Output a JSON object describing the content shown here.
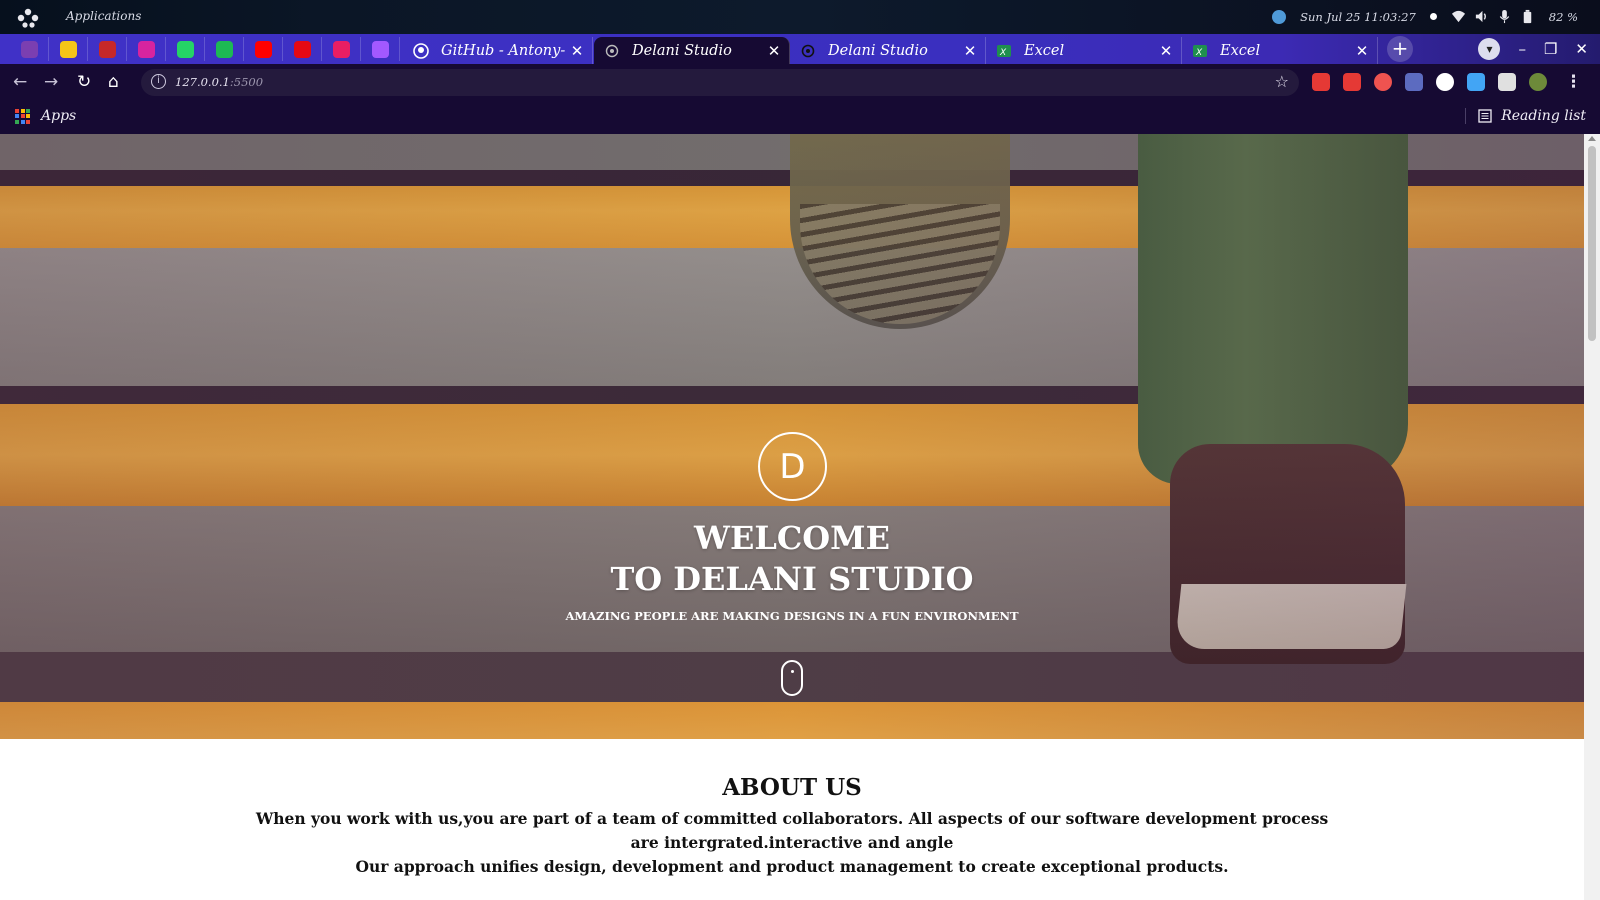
{
  "os_panel": {
    "apps_label": "Applications",
    "datetime": "Sun Jul 25  11:03:27",
    "battery": "82 %"
  },
  "tabs": {
    "pinned": [
      {
        "name": "pinned-tab-1",
        "color": "#7b3fb1"
      },
      {
        "name": "pinned-tab-imdb",
        "color": "#f5c518"
      },
      {
        "name": "pinned-tab-3",
        "color": "#c62828"
      },
      {
        "name": "pinned-tab-instagram",
        "color": "#d6249f"
      },
      {
        "name": "pinned-tab-whatsapp",
        "color": "#25d366"
      },
      {
        "name": "pinned-tab-spotify",
        "color": "#1db954"
      },
      {
        "name": "pinned-tab-youtube",
        "color": "#ff0000"
      },
      {
        "name": "pinned-tab-netflix",
        "color": "#e50914"
      },
      {
        "name": "pinned-tab-9",
        "color": "#e91e63"
      },
      {
        "name": "pinned-tab-figma",
        "color": "#a259ff"
      }
    ],
    "items": [
      {
        "title": "GitHub - Antony-me",
        "active": false
      },
      {
        "title": "Delani Studio",
        "active": true
      },
      {
        "title": "Delani Studio",
        "active": false
      },
      {
        "title": "Excel",
        "active": false
      },
      {
        "title": "Excel",
        "active": false
      }
    ]
  },
  "toolbar": {
    "url_host": "127.0.0.1",
    "url_port": ":5500"
  },
  "bookmarks": {
    "apps_label": "Apps",
    "reading_list_label": "Reading list"
  },
  "hero": {
    "logo_letter": "D",
    "title_line1": "WELCOME",
    "title_line2": "TO DELANI STUDIO",
    "subtitle": "AMAZING PEOPLE ARE MAKING DESIGNS IN A FUN ENVIRONMENT"
  },
  "about": {
    "title": "ABOUT US",
    "paragraph1": "When you work with us,you are part of a team of committed collaborators. All aspects of our software development process are intergrated.interactive and angle",
    "paragraph2": "Our approach unifies design, development and product management to create exceptional products."
  }
}
